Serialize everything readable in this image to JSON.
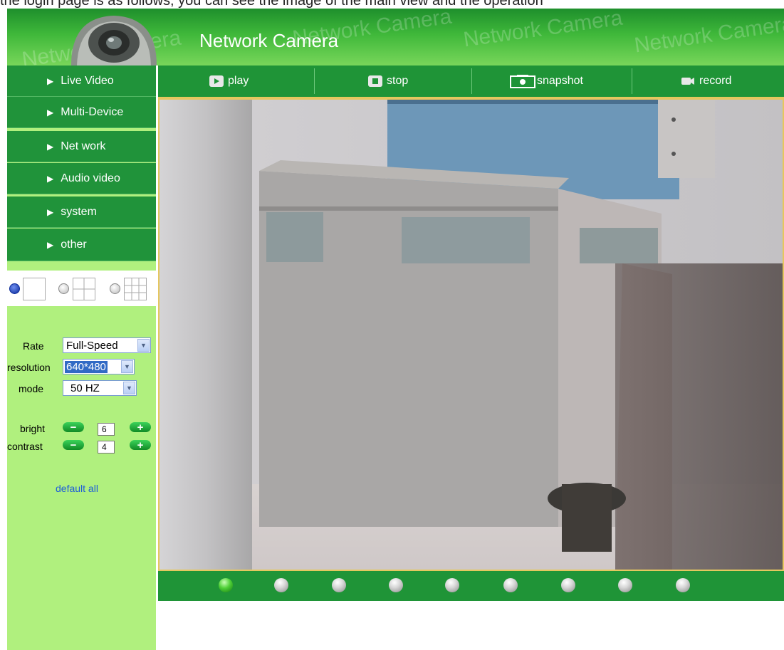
{
  "top_strip_text": "the login page is as follows, you can see the image of the main view and the operation",
  "header": {
    "title": "Network Camera",
    "watermark": "Network Camera"
  },
  "sidebar": {
    "items": [
      {
        "label": "Live Video"
      },
      {
        "label": "Multi-Device"
      },
      {
        "label": "Net work"
      },
      {
        "label": "Audio video"
      },
      {
        "label": "system"
      },
      {
        "label": "other"
      }
    ],
    "layout_options": [
      "single-view",
      "quad-view",
      "nine-view"
    ],
    "layout_selected": "single-view"
  },
  "controls": {
    "rate_label": "Rate",
    "rate_value": "Full-Speed",
    "resolution_label": "resolution",
    "resolution_value": "640*480",
    "mode_label": "mode",
    "mode_value": "50 HZ",
    "bright_label": "bright",
    "bright_value": "6",
    "contrast_label": "contrast",
    "contrast_value": "4",
    "minus_symbol": "−",
    "plus_symbol": "+",
    "default_all": "default all"
  },
  "toolbar": {
    "play": "play",
    "stop": "stop",
    "snapshot": "snapshot",
    "record": "record"
  },
  "channels": {
    "count": 9,
    "active_index": 0
  },
  "colors": {
    "nav_green": "#20933a",
    "sidebar_bg": "#b0f07e",
    "frame_gold": "#e5c75f",
    "link_blue": "#1e5ed8"
  }
}
